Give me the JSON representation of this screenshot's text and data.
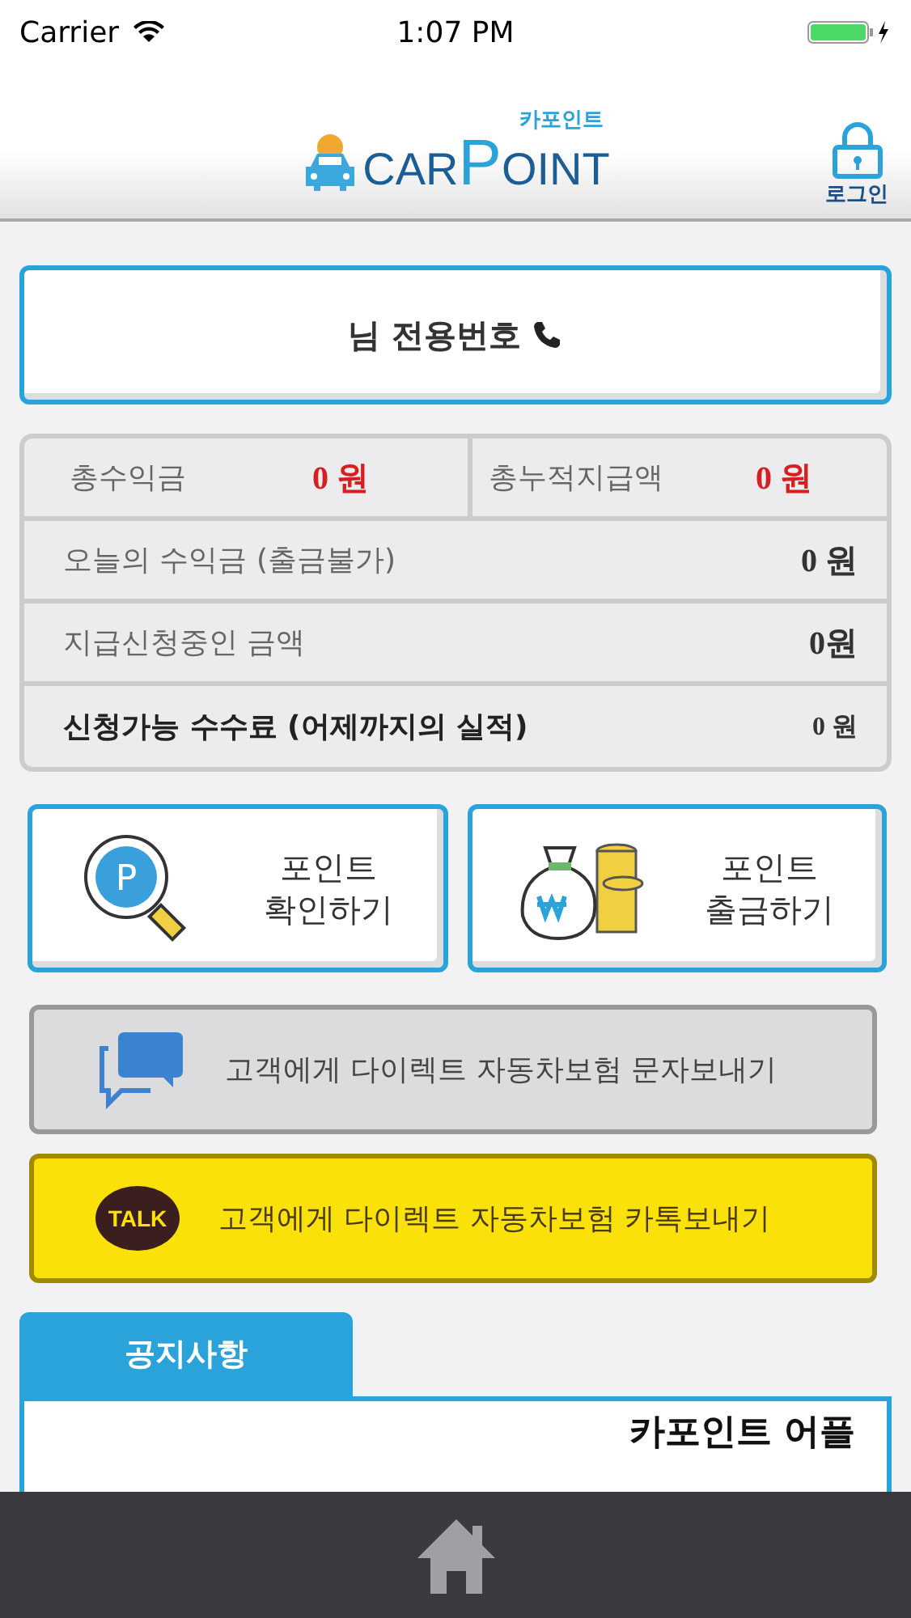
{
  "status_bar": {
    "carrier": "Carrier",
    "time": "1:07 PM"
  },
  "header": {
    "logo": {
      "subtitle": "카포인트",
      "parts": [
        {
          "text": "CAR",
          "kind": "dark"
        },
        {
          "text": "P",
          "kind": "accent"
        },
        {
          "text": "OINT",
          "kind": "dark"
        }
      ]
    },
    "login": "로그인"
  },
  "phone_card": {
    "label": "님 전용번호"
  },
  "stats": [
    {
      "kind": "pair",
      "cells": [
        {
          "label": "총수익금",
          "value": "0 원",
          "highlight": true
        },
        {
          "label": "총누적지급액",
          "value": "0 원",
          "highlight": true
        }
      ]
    },
    {
      "kind": "single",
      "label": "오늘의 수익금 (출금불가)",
      "value": "0 원",
      "bold": false
    },
    {
      "kind": "single",
      "label": "지급신청중인 금액",
      "value": "0원",
      "bold": false
    },
    {
      "kind": "single",
      "label": "신청가능 수수료 (어제까지의 실적)",
      "value": "0 원",
      "bold": true
    }
  ],
  "tiles": [
    {
      "kind": "check",
      "icon_text": "P",
      "line1": "포인트",
      "line2": "확인하기"
    },
    {
      "kind": "withdraw",
      "line1": "포인트",
      "line2": "출금하기"
    }
  ],
  "actions": [
    {
      "kind": "sms",
      "label": "고객에게 다이렉트 자동차보험 문자보내기"
    },
    {
      "kind": "kakao",
      "label": "고객에게 다이렉트 자동차보험 카톡보내기",
      "badge": "TALK"
    }
  ],
  "notice": {
    "tab": "공지사항",
    "text": "카포인트 어플"
  }
}
